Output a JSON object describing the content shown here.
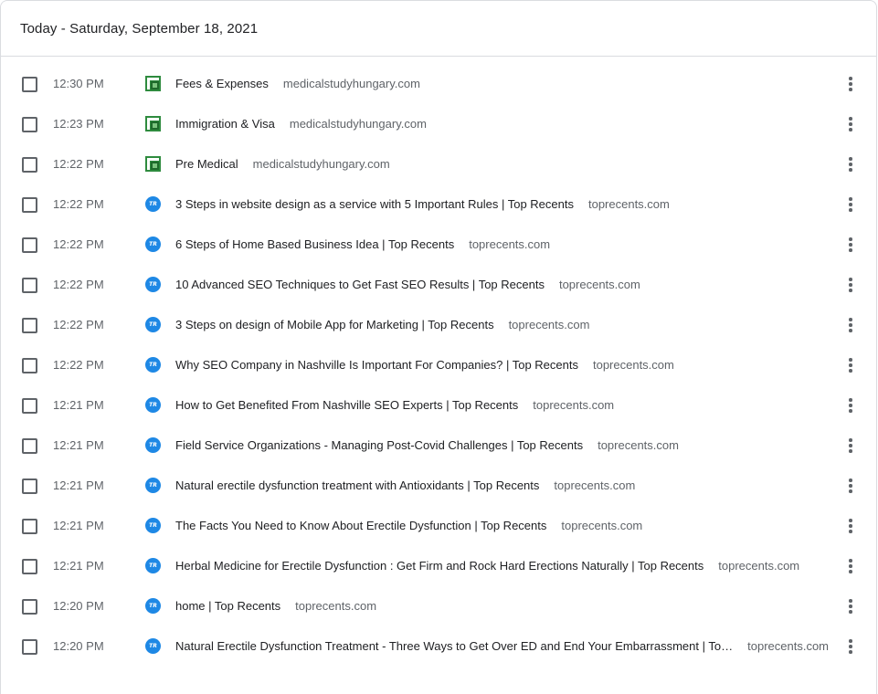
{
  "header": {
    "title": "Today - Saturday, September 18, 2021"
  },
  "icons": {
    "medicalstudyhungary": "msh-favicon-icon",
    "toprecents": "tr-favicon-icon",
    "tr_text": "TR",
    "more": "more-vert-icon"
  },
  "colors": {
    "msh_green": "#2e8b3e",
    "tr_blue": "#1e88e5"
  },
  "entries": [
    {
      "time": "12:30 PM",
      "icon": "msh",
      "title": "Fees & Expenses",
      "domain": "medicalstudyhungary.com"
    },
    {
      "time": "12:23 PM",
      "icon": "msh",
      "title": "Immigration & Visa",
      "domain": "medicalstudyhungary.com"
    },
    {
      "time": "12:22 PM",
      "icon": "msh",
      "title": "Pre Medical",
      "domain": "medicalstudyhungary.com"
    },
    {
      "time": "12:22 PM",
      "icon": "tr",
      "title": "3 Steps in website design as a service with 5 Important Rules | Top Recents",
      "domain": "toprecents.com"
    },
    {
      "time": "12:22 PM",
      "icon": "tr",
      "title": "6 Steps of Home Based Business Idea | Top Recents",
      "domain": "toprecents.com"
    },
    {
      "time": "12:22 PM",
      "icon": "tr",
      "title": "10 Advanced SEO Techniques to Get Fast SEO Results | Top Recents",
      "domain": "toprecents.com"
    },
    {
      "time": "12:22 PM",
      "icon": "tr",
      "title": "3 Steps on design of Mobile App for Marketing | Top Recents",
      "domain": "toprecents.com"
    },
    {
      "time": "12:22 PM",
      "icon": "tr",
      "title": "Why SEO Company in Nashville Is Important For Companies? | Top Recents",
      "domain": "toprecents.com"
    },
    {
      "time": "12:21 PM",
      "icon": "tr",
      "title": "How to Get Benefited From Nashville SEO Experts | Top Recents",
      "domain": "toprecents.com"
    },
    {
      "time": "12:21 PM",
      "icon": "tr",
      "title": "Field Service Organizations - Managing Post-Covid Challenges | Top Recents",
      "domain": "toprecents.com"
    },
    {
      "time": "12:21 PM",
      "icon": "tr",
      "title": "Natural erectile dysfunction treatment with Antioxidants | Top Recents",
      "domain": "toprecents.com"
    },
    {
      "time": "12:21 PM",
      "icon": "tr",
      "title": "The Facts You Need to Know About Erectile Dysfunction | Top Recents",
      "domain": "toprecents.com"
    },
    {
      "time": "12:21 PM",
      "icon": "tr",
      "title": "Herbal Medicine for Erectile Dysfunction : Get Firm and Rock Hard Erections Naturally | Top Recents",
      "domain": "toprecents.com"
    },
    {
      "time": "12:20 PM",
      "icon": "tr",
      "title": "home | Top Recents",
      "domain": "toprecents.com"
    },
    {
      "time": "12:20 PM",
      "icon": "tr",
      "title": "Natural Erectile Dysfunction Treatment - Three Ways to Get Over ED and End Your Embarrassment | Top Recents",
      "domain": "toprecents.com"
    }
  ]
}
